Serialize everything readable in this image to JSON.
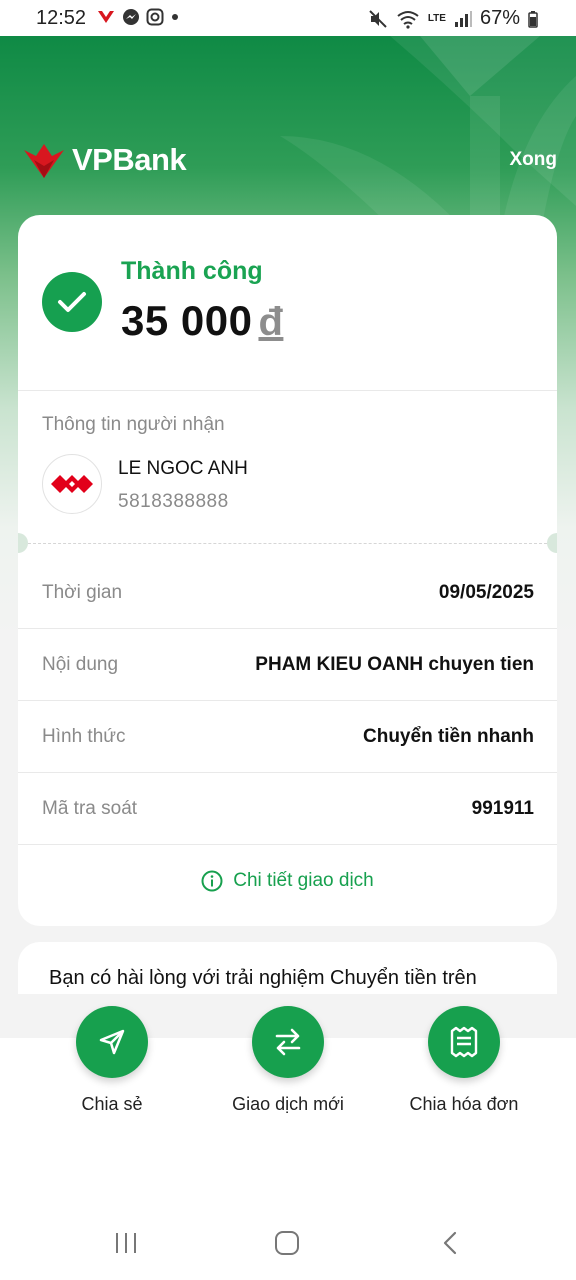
{
  "status_bar": {
    "time": "12:52",
    "battery": "67%",
    "network": "LTE"
  },
  "header": {
    "logo_text": "VPBank",
    "done_label": "Xong"
  },
  "result": {
    "status": "Thành công",
    "amount": "35 000",
    "currency": "đ"
  },
  "recipient": {
    "section_label": "Thông tin người nhận",
    "name": "LE NGOC ANH",
    "account": "5818388888"
  },
  "details": [
    {
      "label": "Thời gian",
      "value": "09/05/2025"
    },
    {
      "label": "Nội dung",
      "value": "PHAM KIEU OANH chuyen tien"
    },
    {
      "label": "Hình thức",
      "value": "Chuyển tiền nhanh"
    },
    {
      "label": "Mã tra soát",
      "value": "991911"
    }
  ],
  "detail_link": "Chi tiết giao dịch",
  "survey": {
    "question": "Bạn có hài lòng với trải nghiệm Chuyển tiền trên VPBank NEO?"
  },
  "actions": [
    {
      "label": "Chia sẻ",
      "icon": "send-icon"
    },
    {
      "label": "Giao dịch mới",
      "icon": "swap-icon"
    },
    {
      "label": "Chia hóa đơn",
      "icon": "receipt-icon"
    }
  ],
  "colors": {
    "brand_green": "#17a04e",
    "brand_red": "#e2001a"
  }
}
